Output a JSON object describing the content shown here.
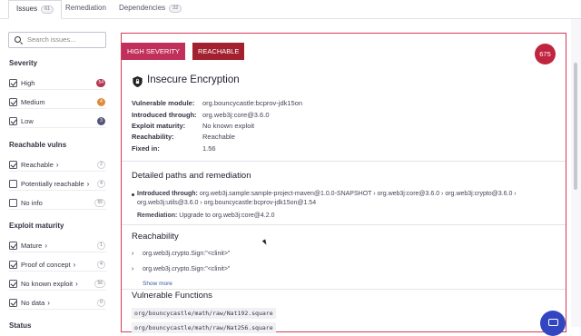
{
  "tabs": [
    {
      "label": "Issues",
      "count": "61"
    },
    {
      "label": "Remediation"
    },
    {
      "label": "Dependencies",
      "count": "32"
    }
  ],
  "search": {
    "placeholder": "Search issues..."
  },
  "filters": {
    "severity": {
      "title": "Severity",
      "items": [
        {
          "label": "High",
          "count": "54",
          "checked": true,
          "color": "#b3384f"
        },
        {
          "label": "Medium",
          "count": "4",
          "checked": true,
          "color": "#e08a3c"
        },
        {
          "label": "Low",
          "count": "3",
          "checked": true,
          "color": "#55557a"
        }
      ]
    },
    "reachable": {
      "title": "Reachable vulns",
      "items": [
        {
          "label": "Reachable",
          "count": "2",
          "checked": true
        },
        {
          "label": "Potentially reachable",
          "count": "4",
          "checked": false
        },
        {
          "label": "No info",
          "count": "55",
          "checked": false
        }
      ]
    },
    "exploit": {
      "title": "Exploit maturity",
      "items": [
        {
          "label": "Mature",
          "count": "1",
          "checked": true
        },
        {
          "label": "Proof of concept",
          "count": "4",
          "checked": true
        },
        {
          "label": "No known exploit",
          "count": "56",
          "checked": true
        },
        {
          "label": "No data",
          "count": "0",
          "checked": true
        }
      ]
    },
    "status": {
      "title": "Status"
    }
  },
  "issue": {
    "tags": [
      "HIGH SEVERITY",
      "REACHABLE"
    ],
    "tag_colors": [
      "#c0305a",
      "#a3212f"
    ],
    "score": "675",
    "title": "Insecure Encryption",
    "meta": [
      {
        "key": "Vulnerable module:",
        "value": "org.bouncycastle:bcprov-jdk15on"
      },
      {
        "key": "Introduced through:",
        "value": "org.web3j:core@3.6.0"
      },
      {
        "key": "Exploit maturity:",
        "value": "No known exploit"
      },
      {
        "key": "Reachability:",
        "value": "Reachable"
      },
      {
        "key": "Fixed in:",
        "value": "1.56"
      }
    ],
    "paths_title": "Detailed paths and remediation",
    "path_label": "Introduced through:",
    "path_value": "org.web3j.sample:sample-project-maven@1.0.0-SNAPSHOT › org.web3j:core@3.6.0 › org.web3j:crypto@3.6.0 › org.web3j:utils@3.6.0 › org.bouncycastle:bcprov-jdk15on@1.54",
    "remediation_label": "Remediation:",
    "remediation_value": "Upgrade to org.web3j:core@4.2.0",
    "reachability_title": "Reachability",
    "reachability_items": [
      "org.web3j.crypto.Sign:\"<clinit>\"",
      "org.web3j.crypto.Sign:\"<clinit>\""
    ],
    "show_more": "Show more",
    "vuln_functions_title": "Vulnerable Functions",
    "vuln_functions": [
      "org/bouncycastle/math/raw/Nat192.square",
      "org/bouncycastle/math/raw/Nat256.square"
    ]
  }
}
